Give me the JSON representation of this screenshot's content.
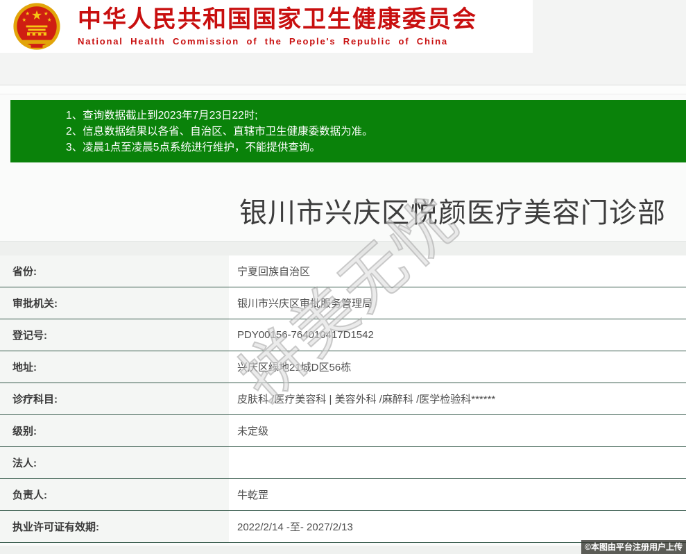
{
  "header": {
    "emblem_icon": "china-national-emblem",
    "title_cn": "中华人民共和国国家卫生健康委员会",
    "title_en": "National Health Commission of the People's Republic of China"
  },
  "notice": {
    "lines": [
      "1、查询数据截止到2023年7月23日22时;",
      "2、信息数据结果以各省、自治区、直辖市卫生健康委数据为准。",
      "3、凌晨1点至凌晨5点系统进行维护，不能提供查询。"
    ]
  },
  "result": {
    "title": "银川市兴庆区悦颜医疗美容门诊部",
    "fields": [
      {
        "label": "省份:",
        "value": "宁夏回族自治区"
      },
      {
        "label": "审批机关:",
        "value": "银川市兴庆区审批服务管理局"
      },
      {
        "label": "登记号:",
        "value": "PDY00156-764010417D1542"
      },
      {
        "label": "地址:",
        "value": "兴庆区绿地21城D区56栋"
      },
      {
        "label": "诊疗科目:",
        "value": "皮肤科 /医疗美容科 | 美容外科 /麻醉科 /医学检验科******"
      },
      {
        "label": "级别:",
        "value": "未定级"
      },
      {
        "label": "法人:",
        "value": ""
      },
      {
        "label": "负责人:",
        "value": "牛乾罡"
      },
      {
        "label": "执业许可证有效期:",
        "value": "2022/2/14 -至- 2027/2/13"
      }
    ]
  },
  "watermarks": {
    "diagonal": "拼美无忧",
    "corner": "©本图由平台注册用户上传"
  },
  "colors": {
    "header_red": "#c80f0f",
    "notice_green": "#0a820a",
    "row_border_green": "#35594a",
    "label_cell_bg": "#f4f6f4"
  }
}
